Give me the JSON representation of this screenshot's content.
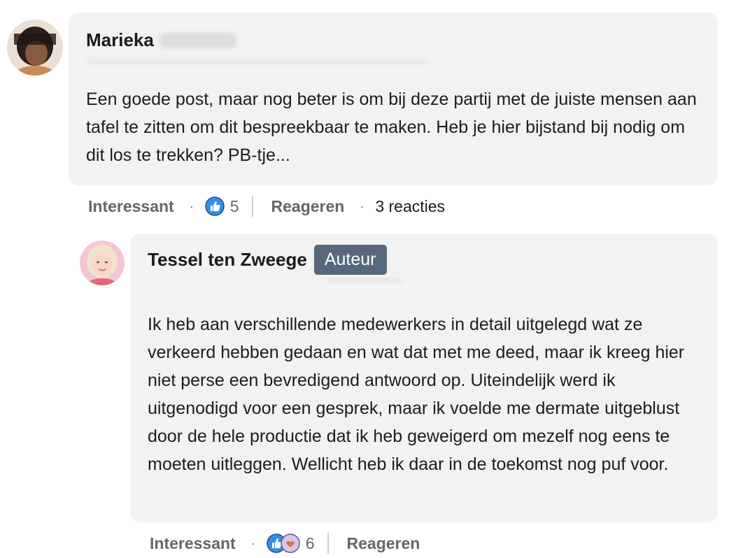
{
  "comments": [
    {
      "author": "Marieka",
      "text": "Een goede post, maar nog beter is om bij deze partij met de juiste mensen aan tafel te zitten om dit bespreekbaar te maken. Heb je hier bijstand bij nodig om dit los te trekken? PB-tje...",
      "actions": {
        "like_label": "Interessant",
        "reaction_count": "5",
        "reply_label": "Reageren",
        "replies_text": "3 reacties"
      }
    },
    {
      "author": "Tessel ten Zweege",
      "badge": "Auteur",
      "text": "Ik heb aan verschillende medewerkers in detail uitgelegd wat ze verkeerd hebben gedaan en wat dat met me deed, maar ik kreeg hier niet perse een bevredigend antwoord op. Uiteindelijk werd ik uitgenodigd voor een gesprek, maar ik voelde me dermate uitgeblust door de hele productie dat ik heb geweigerd om mezelf nog eens te moeten uitleggen. Wellicht heb ik daar in de toekomst nog puf voor.",
      "actions": {
        "like_label": "Interessant",
        "reaction_count": "6",
        "reply_label": "Reageren"
      }
    }
  ],
  "colors": {
    "bubble": "#f2f2f2",
    "badge": "#56687a",
    "like_blue": "#378fe9"
  },
  "icons": [
    "avatar-marieka",
    "avatar-tessel",
    "like-reaction-icon",
    "love-reaction-icon"
  ]
}
